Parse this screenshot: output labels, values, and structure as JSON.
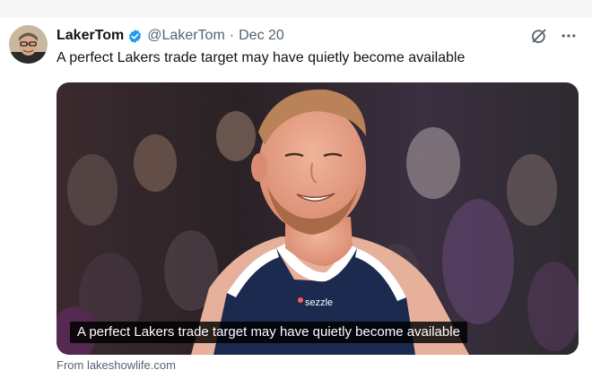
{
  "tweet": {
    "author_name": "LakerTom",
    "handle": "@LakerTom",
    "separator": "·",
    "date": "Dec 20",
    "text": "A perfect Lakers trade target may have quietly become available"
  },
  "media": {
    "caption": "A perfect Lakers trade target may have quietly become available",
    "jersey_brand": "sezzle",
    "source_label": "From lakeshowlife.com"
  },
  "icons": {
    "verified": "verified-badge-icon",
    "grok": "grok-icon",
    "more": "more-options-icon"
  },
  "colors": {
    "verified_blue": "#1d9bf0",
    "text_primary": "#0f1419",
    "text_secondary": "#536471",
    "jersey_navy": "#1b2a4e"
  }
}
